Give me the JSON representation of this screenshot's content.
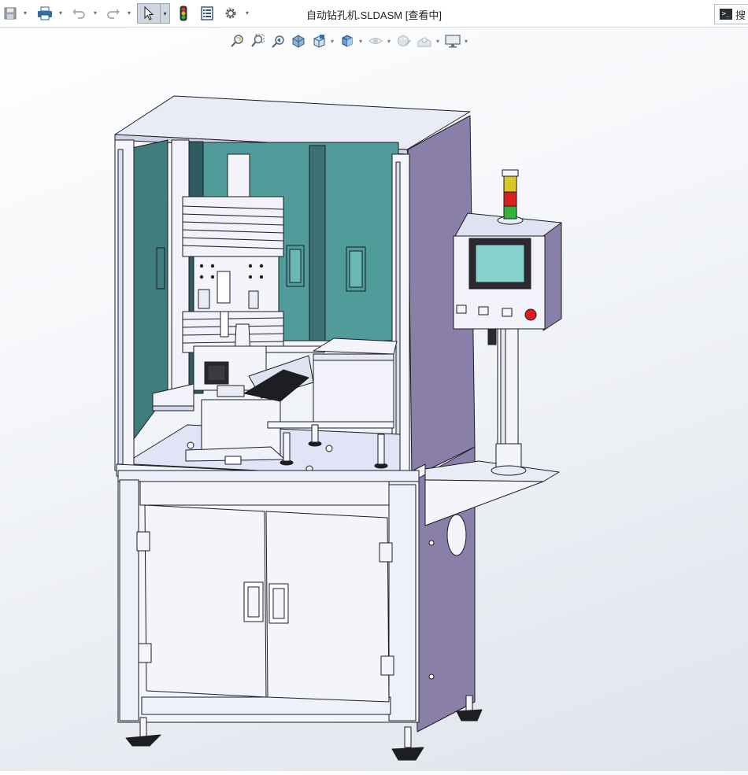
{
  "window": {
    "title": "自动钻孔机.SLDASM [查看中]",
    "search_label": "搜"
  },
  "toolbar": {
    "items": [
      "save-icon",
      "print-icon",
      "undo-icon",
      "redo-icon",
      "select-arrow-icon",
      "rebuild-traffic-light-icon",
      "file-properties-icon",
      "options-gear-icon"
    ]
  },
  "headsup_toolbar": {
    "items": [
      "zoom-to-fit-icon",
      "zoom-to-area-icon",
      "previous-view-icon",
      "section-view-icon",
      "view-orientation-icon",
      "display-style-icon",
      "hide-show-items-icon",
      "edit-appearance-icon",
      "apply-scene-icon",
      "view-settings-icon"
    ]
  },
  "colors": {
    "panel": "#e9ebf7",
    "side_panel": "#8a7fa8",
    "glass": "#4f9c9b",
    "frame": "#f4f5fb",
    "light_red": "#d9201f",
    "light_yellow": "#d7c828",
    "light_green": "#32b23a",
    "screen": "#88d3cf"
  }
}
